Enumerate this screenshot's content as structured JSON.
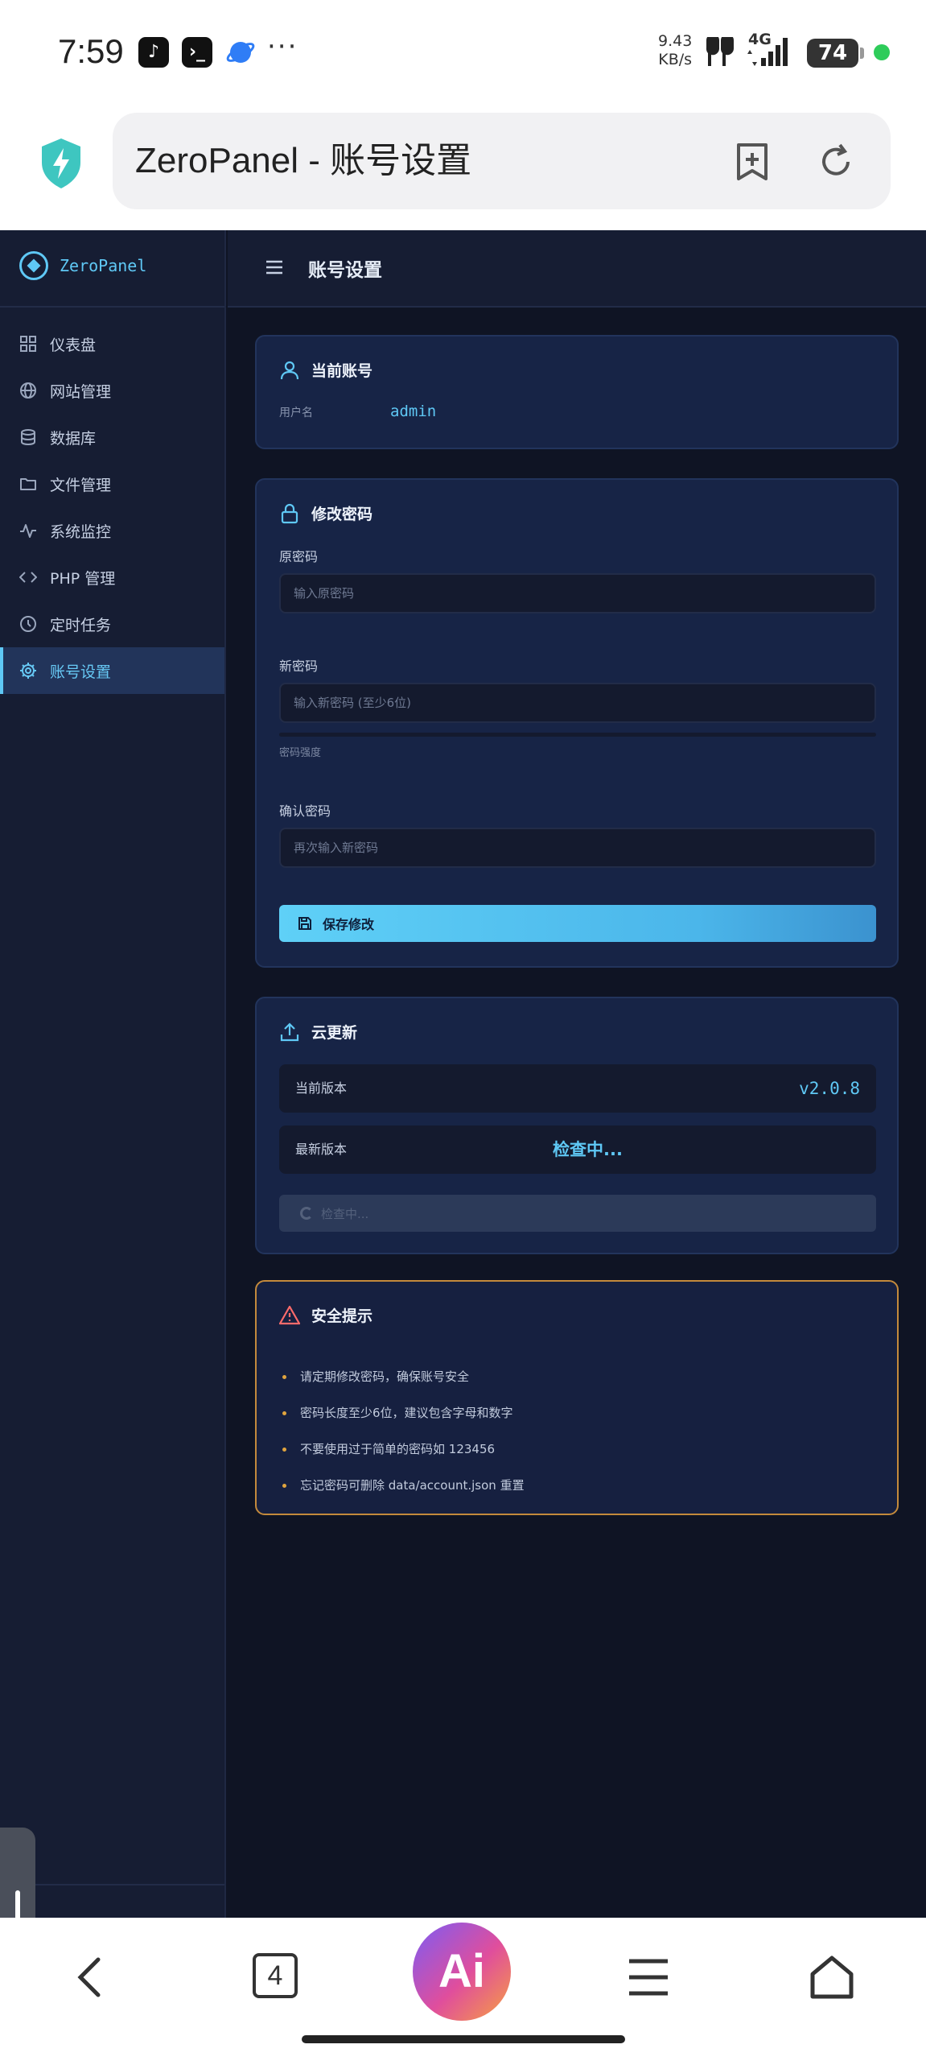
{
  "status_bar": {
    "time": "7:59",
    "speed_value": "9.43",
    "speed_unit": "KB/s",
    "network": "4G",
    "battery": "74"
  },
  "browser": {
    "url_title": "ZeroPanel - 账号设置",
    "tab_count": "4",
    "ai_label": "Ai"
  },
  "sidebar": {
    "brand": "ZeroPanel",
    "items": [
      {
        "label": "仪表盘",
        "icon": "grid-icon"
      },
      {
        "label": "网站管理",
        "icon": "globe-icon"
      },
      {
        "label": "数据库",
        "icon": "database-icon"
      },
      {
        "label": "文件管理",
        "icon": "folder-icon"
      },
      {
        "label": "系统监控",
        "icon": "activity-icon"
      },
      {
        "label": "PHP 管理",
        "icon": "code-icon"
      },
      {
        "label": "定时任务",
        "icon": "clock-icon"
      },
      {
        "label": "账号设置",
        "icon": "gear-icon",
        "active": true
      }
    ]
  },
  "topbar": {
    "title": "账号设置"
  },
  "account_card": {
    "title": "当前账号",
    "username_label": "用户名",
    "username": "admin"
  },
  "password_card": {
    "title": "修改密码",
    "old_label": "原密码",
    "old_placeholder": "输入原密码",
    "new_label": "新密码",
    "new_placeholder": "输入新密码 (至少6位)",
    "strength_label": "密码强度",
    "strength_value": 0,
    "confirm_label": "确认密码",
    "confirm_placeholder": "再次输入新密码",
    "save_label": "保存修改"
  },
  "update_card": {
    "title": "云更新",
    "current_label": "当前版本",
    "current_version": "v2.0.8",
    "latest_label": "最新版本",
    "latest_version": "检查中...",
    "check_button": "检查中..."
  },
  "security_card": {
    "title": "安全提示",
    "tips": [
      "请定期修改密码，确保账号安全",
      "密码长度至少6位，建议包含字母和数字",
      "不要使用过于简单的密码如 123456",
      "忘记密码可删除 data/account.json 重置"
    ]
  },
  "colors": {
    "accent": "#5fc8f5",
    "background": "#0f1424",
    "card": "#172446",
    "warning_border": "#c48a3c"
  }
}
